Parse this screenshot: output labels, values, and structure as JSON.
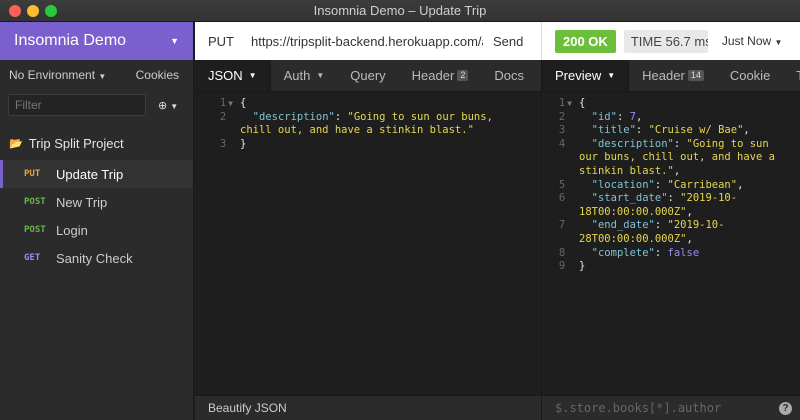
{
  "window": {
    "title": "Insomnia Demo – Update Trip"
  },
  "sidebar": {
    "workspace": "Insomnia Demo",
    "environment": "No Environment",
    "cookies": "Cookies",
    "filter_placeholder": "Filter",
    "folder": "Trip Split Project",
    "requests": [
      {
        "method": "PUT",
        "name": "Update Trip"
      },
      {
        "method": "POST",
        "name": "New Trip"
      },
      {
        "method": "POST",
        "name": "Login"
      },
      {
        "method": "GET",
        "name": "Sanity Check"
      }
    ]
  },
  "request": {
    "method": "PUT",
    "url": "https://tripsplit-backend.herokuapp.com/a",
    "send": "Send",
    "tabs": {
      "json": "JSON",
      "auth": "Auth",
      "query": "Query",
      "header": "Header",
      "header_count": "2",
      "docs": "Docs"
    },
    "body_lines": [
      {
        "n": "1",
        "t": "{"
      },
      {
        "n": "2",
        "key": "\"description\"",
        "val": "\"Going to sun our buns, chill out, and have a stinkin blast.\""
      },
      {
        "n": "3",
        "t": "}"
      }
    ],
    "beautify": "Beautify JSON"
  },
  "response": {
    "status": "200 OK",
    "time": "TIME 56.7 ms",
    "when": "Just Now",
    "tabs": {
      "preview": "Preview",
      "header": "Header",
      "header_count": "14",
      "cookie": "Cookie",
      "timeline": "T"
    },
    "lines": [
      {
        "n": "1",
        "t": "{"
      },
      {
        "n": "2",
        "key": "\"id\"",
        "num": "7"
      },
      {
        "n": "3",
        "key": "\"title\"",
        "val": "\"Cruise w/ Bae\""
      },
      {
        "n": "4",
        "key": "\"description\"",
        "val": "\"Going to sun our buns, chill out, and have a stinkin blast.\""
      },
      {
        "n": "5",
        "key": "\"location\"",
        "val": "\"Carribean\""
      },
      {
        "n": "6",
        "key": "\"start_date\"",
        "val": "\"2019-10-18T00:00:00.000Z\""
      },
      {
        "n": "7",
        "key": "\"end_date\"",
        "val": "\"2019-10-28T00:00:00.000Z\""
      },
      {
        "n": "8",
        "key": "\"complete\"",
        "bool": "false"
      },
      {
        "n": "9",
        "t": "}"
      }
    ],
    "filter_placeholder": "$.store.books[*].author"
  },
  "colors": {
    "accent": "#7a5fcf",
    "status_ok": "#6dbf3b",
    "put": "#e8a343",
    "post": "#65b84a",
    "get": "#9a8cf0"
  }
}
